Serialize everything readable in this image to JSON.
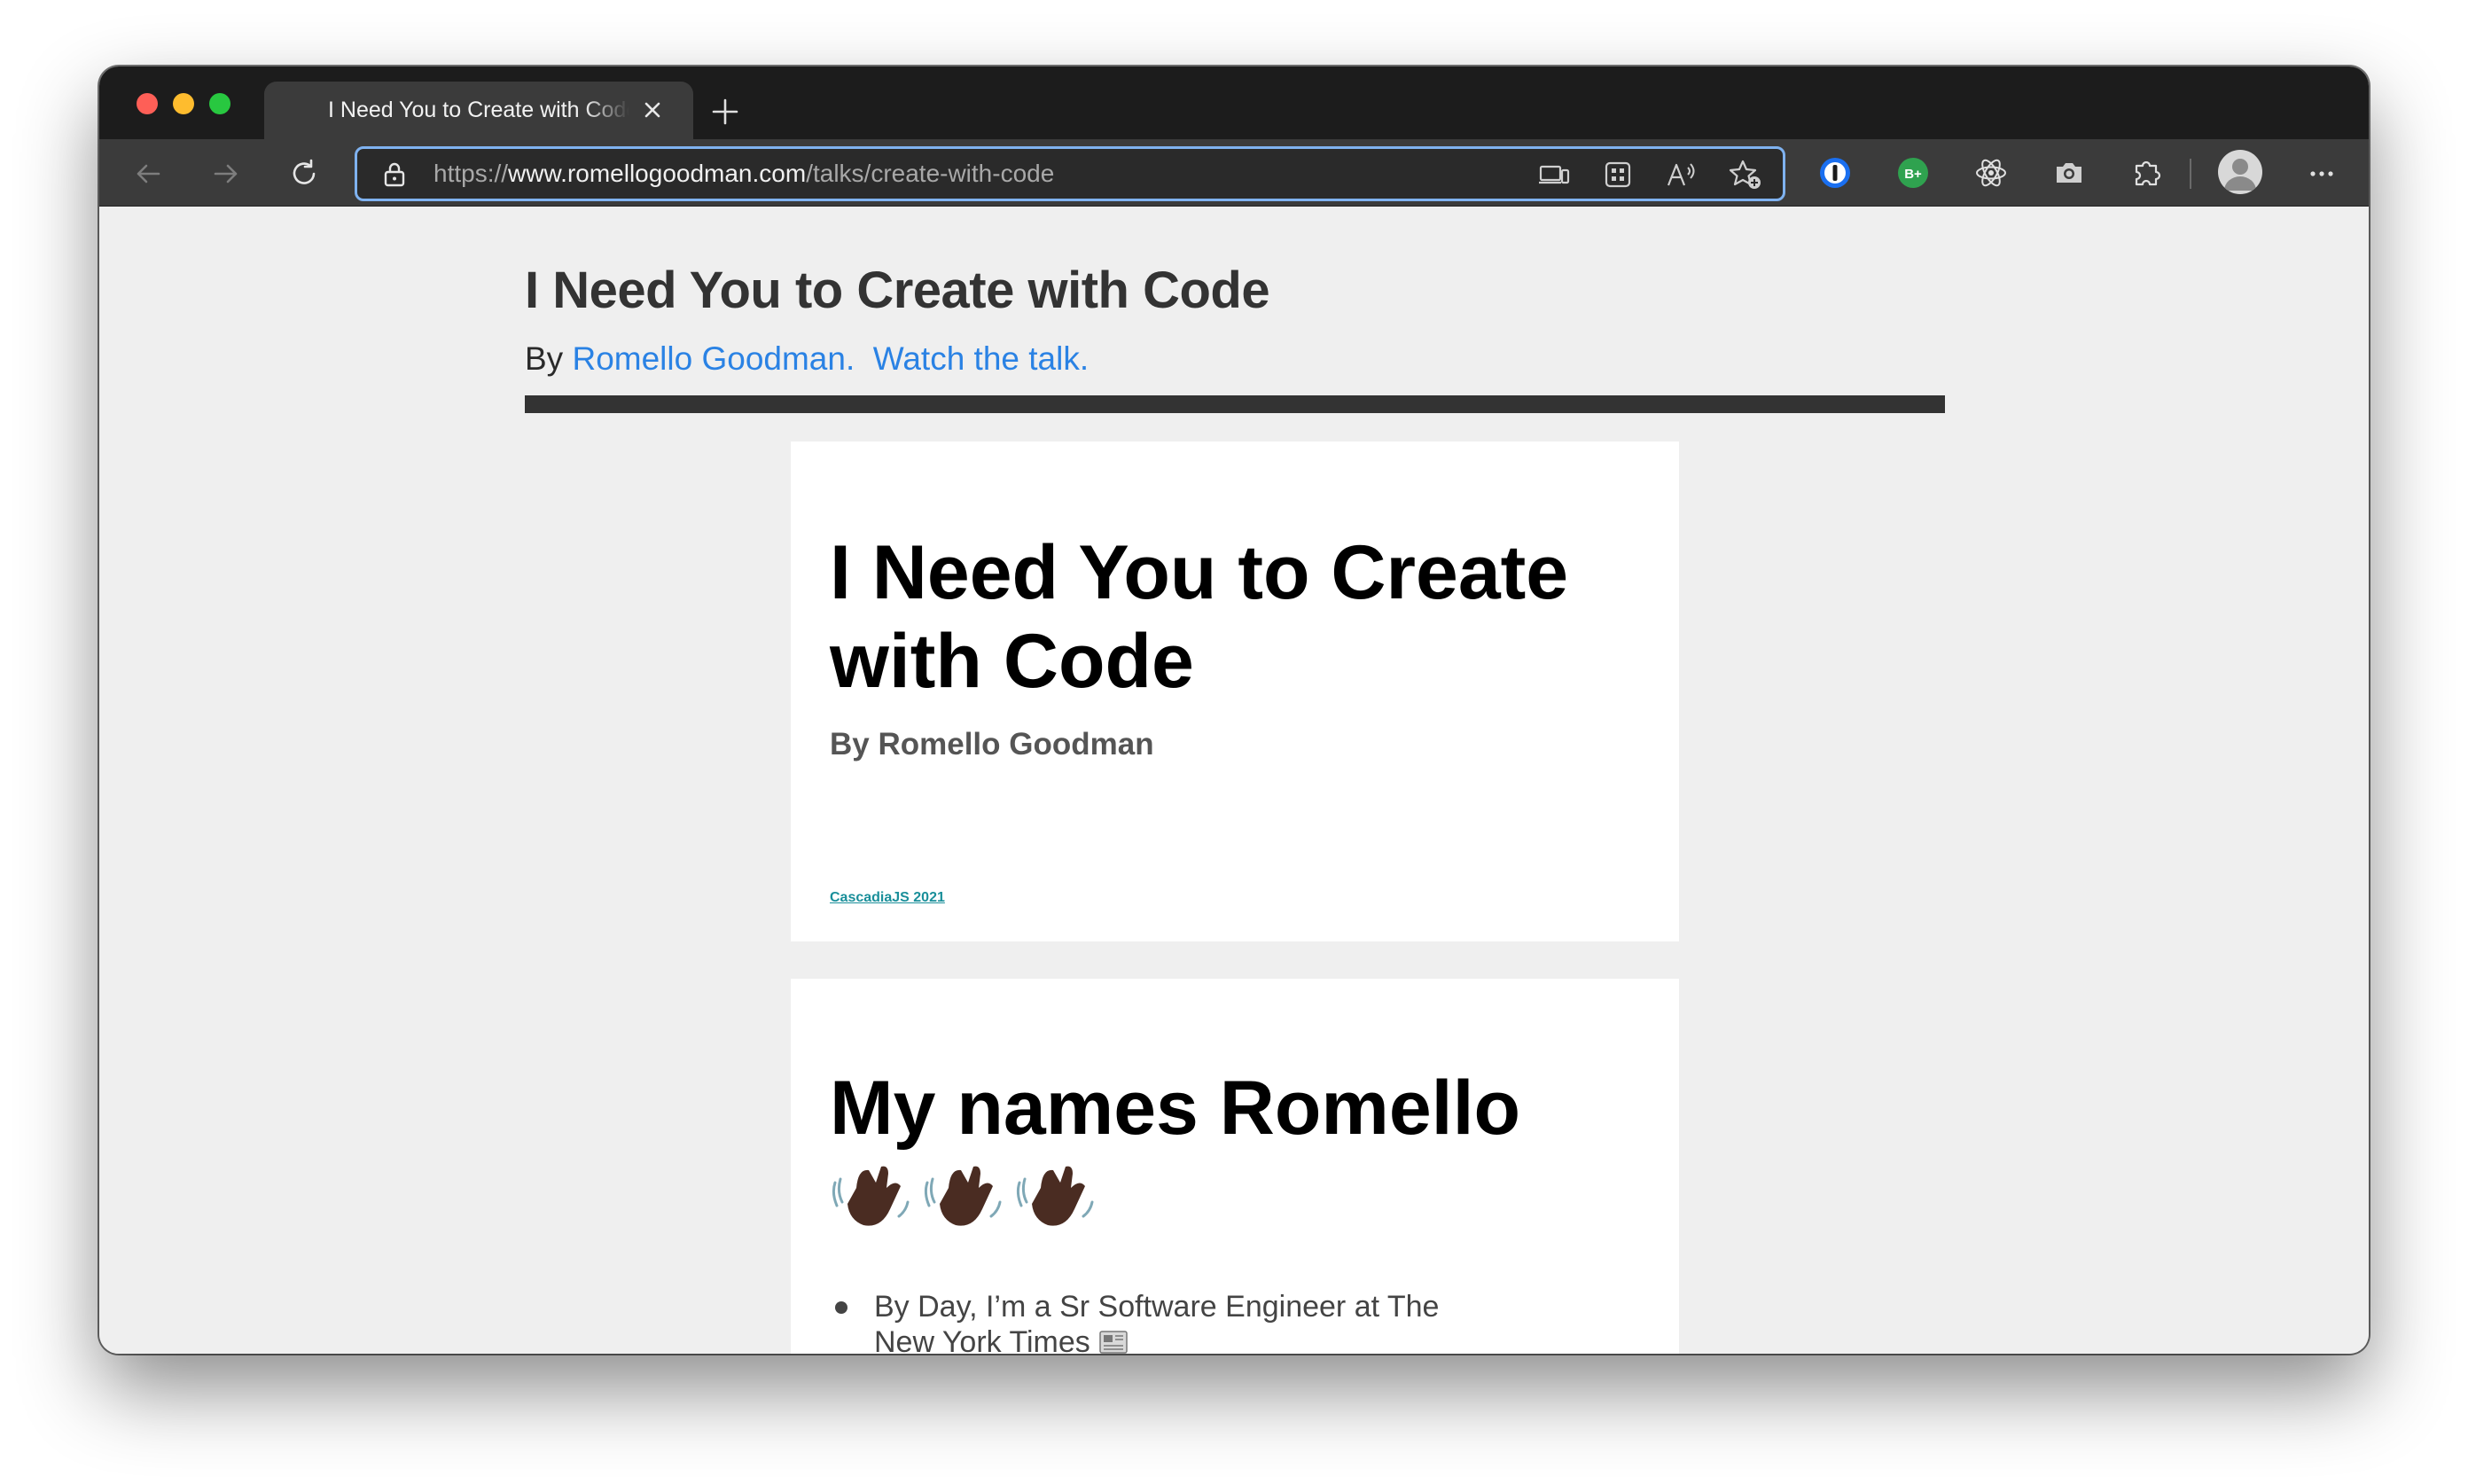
{
  "browser": {
    "tab": {
      "title": "I Need You to Create with Code"
    },
    "address_bar": {
      "scheme": "https://",
      "host": "www.romellogoodman.com",
      "path": "/talks/create-with-code"
    },
    "extensions": [
      {
        "name": "1password-icon",
        "label": "1"
      },
      {
        "name": "grammar-extension-icon",
        "label": "B+"
      },
      {
        "name": "react-devtools-icon"
      },
      {
        "name": "camera-icon"
      },
      {
        "name": "extensions-puzzle-icon"
      }
    ],
    "colors": {
      "tab_strip": "#1c1c1c",
      "toolbar": "#3b3b3b",
      "focus_ring": "#7fb2f0"
    }
  },
  "page": {
    "title": "I Need You to Create with Code",
    "byline": {
      "prefix": "By",
      "author": "Romello Goodman.",
      "watch": "Watch the talk."
    },
    "link_color": "#2a82e4",
    "slides": [
      {
        "title": "I Need You to Create with Code",
        "subtitle": "By Romello Goodman",
        "event_link": "CascadiaJS 2021"
      },
      {
        "title": "My names Romello",
        "bullets": [
          "By Day, I’m a Sr Software Engineer at The New York Times"
        ]
      }
    ]
  }
}
